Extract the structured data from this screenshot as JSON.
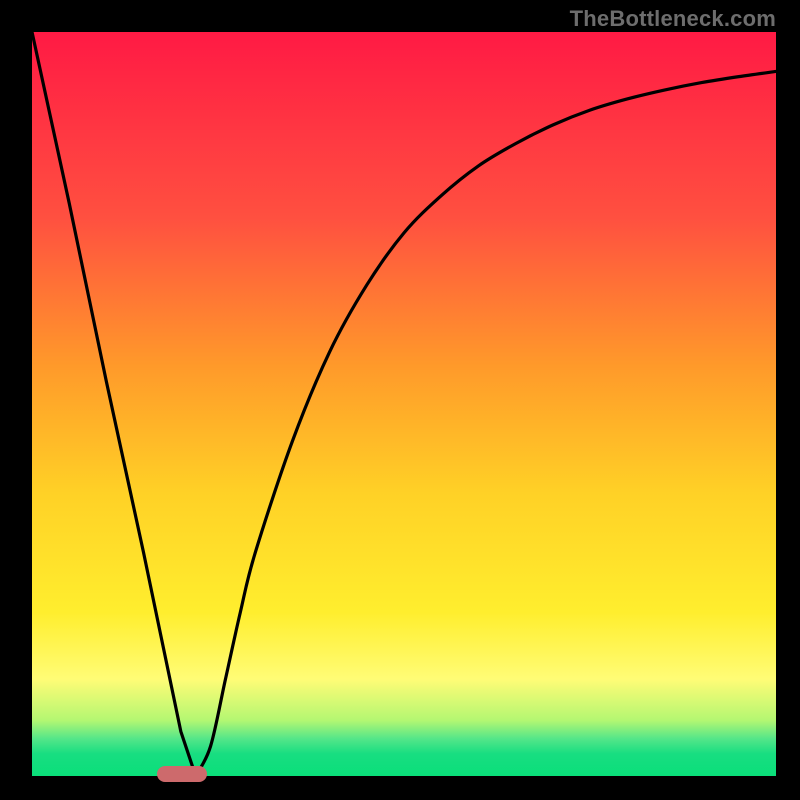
{
  "watermark": "TheBottleneck.com",
  "colors": {
    "background": "#000000",
    "marker": "#cd6a6c",
    "curve": "#000000",
    "gradient_top": "#ff1a44",
    "gradient_bottom": "#0adf7a"
  },
  "chart_data": {
    "type": "line",
    "title": "",
    "xlabel": "",
    "ylabel": "",
    "xlim": [
      0,
      100
    ],
    "ylim": [
      0,
      100
    ],
    "notes": "V-shaped bottleneck curve; y≈0 is optimal (green), y≈100 is worst (red). Left branch is linear, right branch rises asymptotically.",
    "x": [
      0,
      5,
      10,
      15,
      20,
      22,
      24,
      26,
      28,
      30,
      35,
      40,
      45,
      50,
      55,
      60,
      65,
      70,
      75,
      80,
      85,
      90,
      95,
      100
    ],
    "y": [
      100,
      77,
      53,
      30,
      6,
      0,
      4,
      13,
      22,
      30,
      45,
      57,
      66,
      73,
      78,
      82,
      85,
      87.5,
      89.5,
      91,
      92.2,
      93.2,
      94,
      94.7
    ],
    "optimum_x": 22,
    "marker": {
      "x_start": 18,
      "x_end": 25,
      "y": 0
    }
  }
}
